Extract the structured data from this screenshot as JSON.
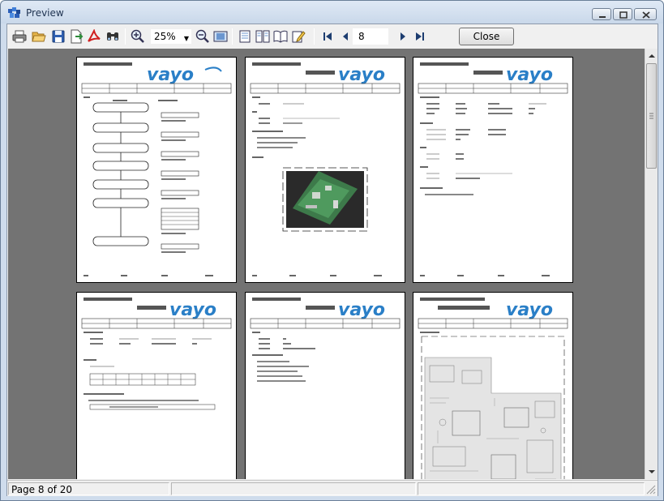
{
  "window": {
    "title": "Preview",
    "icon": "preview-app-icon"
  },
  "toolbar": {
    "zoom_value": "25%",
    "page_value": "8",
    "close_label": "Close",
    "icons": [
      "print-icon",
      "open-icon",
      "save-icon",
      "export-icon",
      "pdf-icon",
      "find-icon",
      "zoom-in-icon",
      "zoom-out-icon",
      "fit-page-icon",
      "single-page-icon",
      "two-pages-icon",
      "book-icon",
      "edit-icon",
      "first-page-icon",
      "prev-page-icon",
      "next-page-icon",
      "last-page-icon"
    ]
  },
  "thumbnails": {
    "brand": "vayo",
    "company": "Vayo Information Technology Co., Ltd",
    "count_visible": 6
  },
  "status": {
    "page_info": "Page 8 of 20"
  },
  "colors": {
    "preview_background": "#737373",
    "brand_blue": "#2a7fc7",
    "window_frame": "#cfdcec"
  }
}
